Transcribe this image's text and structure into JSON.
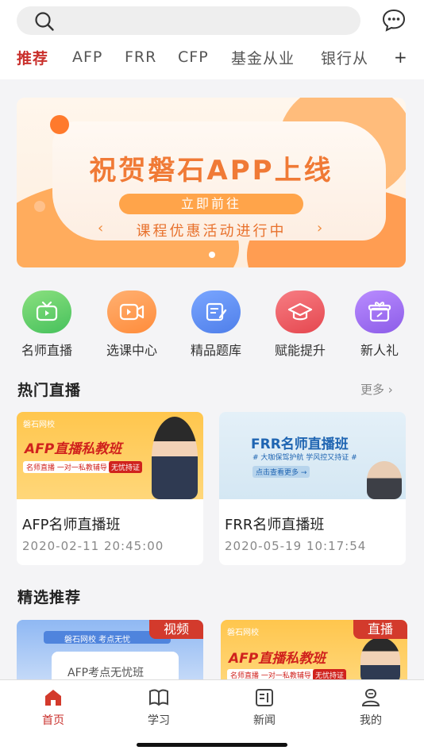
{
  "tabs": [
    "推荐",
    "AFP",
    "FRR",
    "CFP",
    "基金从业",
    "银行从"
  ],
  "tab_plus": "+",
  "banner": {
    "title": "祝贺磐石APP上线",
    "cta": "立即前往",
    "subtitle": "课程优惠活动进行中",
    "left_arrow": "‹",
    "right_arrow": "›"
  },
  "categories": [
    {
      "label": "名师直播",
      "icon": "tv-icon",
      "color": "#5ccf6a"
    },
    {
      "label": "选课中心",
      "icon": "video-camera-icon",
      "color": "#ff9a4d"
    },
    {
      "label": "精品题库",
      "icon": "edit-note-icon",
      "color": "#5b8def"
    },
    {
      "label": "赋能提升",
      "icon": "graduation-cap-icon",
      "color": "#ec5a62"
    },
    {
      "label": "新人礼",
      "icon": "gift-icon",
      "color": "#a06ef0"
    }
  ],
  "hot_live": {
    "title": "热门直播",
    "more": "更多 ›",
    "cards": [
      {
        "title": "AFP名师直播班",
        "time": "2020-02-11 20:45:00",
        "thumb_logo": "磐石网校",
        "thumb_heading": "AFP直播私教班",
        "thumb_tag": "名师直播 一对一私教辅导",
        "thumb_badge": "无忧持证"
      },
      {
        "title": "FRR名师直播班",
        "time": "2020-05-19 10:17:54",
        "thumb_heading": "FRR名师直播班",
        "thumb_tag": "# 大咖保驾护航 学风控又持证 #",
        "thumb_link": "点击查看更多 →"
      }
    ]
  },
  "featured": {
    "title": "精选推荐",
    "items": [
      {
        "badge": "视频",
        "logo": "磐石网校  考点无忧",
        "heading": "AFP考点无忧班"
      },
      {
        "badge": "直播",
        "logo": "磐石网校",
        "heading": "AFP直播私教班",
        "tag": "名师直播 一对一私教辅导",
        "tag_badge": "无忧持证"
      }
    ]
  },
  "tabbar": [
    {
      "label": "首页",
      "icon": "home-icon",
      "active": true
    },
    {
      "label": "学习",
      "icon": "book-icon",
      "active": false
    },
    {
      "label": "新闻",
      "icon": "news-icon",
      "active": false
    },
    {
      "label": "我的",
      "icon": "profile-icon",
      "active": false
    }
  ],
  "colors": {
    "accent": "#c9302c",
    "banner_orange": "#f07a36"
  }
}
